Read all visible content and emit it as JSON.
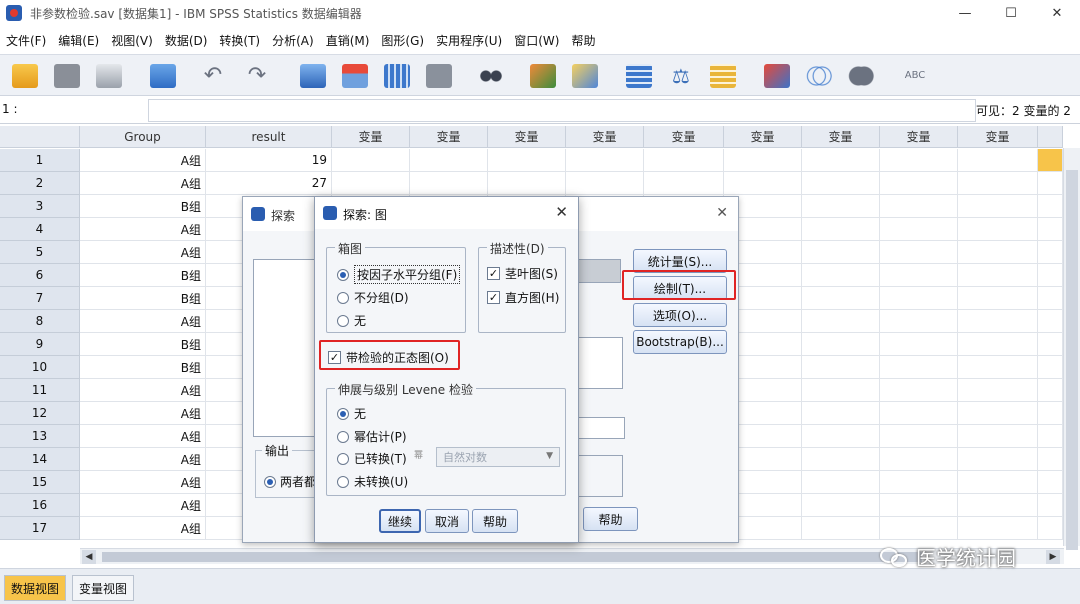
{
  "window": {
    "title": "非参数检验.sav [数据集1] - IBM SPSS Statistics 数据编辑器",
    "min": "—",
    "max": "☐",
    "close": "✕"
  },
  "menu": [
    "文件(F)",
    "编辑(E)",
    "视图(V)",
    "数据(D)",
    "转换(T)",
    "分析(A)",
    "直销(M)",
    "图形(G)",
    "实用程序(U)",
    "窗口(W)",
    "帮助"
  ],
  "cellbar": {
    "ref": "1 :",
    "visible": "可见：2 变量的 2"
  },
  "grid": {
    "columns": [
      "Group",
      "result",
      "变量",
      "变量",
      "变量",
      "变量",
      "变量",
      "变量",
      "变量",
      "变量",
      "变量",
      "变量"
    ],
    "rows": [
      {
        "n": "1",
        "group": "A组",
        "result": "19"
      },
      {
        "n": "2",
        "group": "A组",
        "result": "27"
      },
      {
        "n": "3",
        "group": "B组",
        "result": ""
      },
      {
        "n": "4",
        "group": "A组",
        "result": ""
      },
      {
        "n": "5",
        "group": "A组",
        "result": ""
      },
      {
        "n": "6",
        "group": "B组",
        "result": ""
      },
      {
        "n": "7",
        "group": "B组",
        "result": ""
      },
      {
        "n": "8",
        "group": "A组",
        "result": ""
      },
      {
        "n": "9",
        "group": "B组",
        "result": ""
      },
      {
        "n": "10",
        "group": "B组",
        "result": ""
      },
      {
        "n": "11",
        "group": "A组",
        "result": ""
      },
      {
        "n": "12",
        "group": "A组",
        "result": ""
      },
      {
        "n": "13",
        "group": "A组",
        "result": ""
      },
      {
        "n": "14",
        "group": "A组",
        "result": ""
      },
      {
        "n": "15",
        "group": "A组",
        "result": ""
      },
      {
        "n": "16",
        "group": "A组",
        "result": ""
      },
      {
        "n": "17",
        "group": "A组",
        "result": ""
      }
    ]
  },
  "bottom_tabs": {
    "data_view": "数据视图",
    "variable_view": "变量视图"
  },
  "explore_dialog": {
    "title": "探索",
    "close": "✕",
    "statistics_button": "统计量(S)...",
    "plots_button": "绘制(T)...",
    "options_button": "选项(O)...",
    "bootstrap_button": "Bootstrap(B)...",
    "output_legend": "输出",
    "output_option": "两者都",
    "help_button": "帮助"
  },
  "plots_dialog": {
    "title": "探索: 图",
    "close": "✕",
    "boxplot_legend": "箱图",
    "boxplot_options": [
      {
        "label": "按因子水平分组(F)",
        "selected": true
      },
      {
        "label": "不分组(D)",
        "selected": false
      },
      {
        "label": "无",
        "selected": false
      }
    ],
    "descriptive_legend": "描述性(D)",
    "descriptive_options": [
      {
        "label": "茎叶图(S)",
        "checked": true
      },
      {
        "label": "直方图(H)",
        "checked": true
      }
    ],
    "normality_label": "带检验的正态图(O)",
    "normality_checked": true,
    "levene_legend": "伸展与级别 Levene 检验",
    "levene_options": [
      {
        "label": "无",
        "selected": true
      },
      {
        "label": "幂估计(P)",
        "selected": false
      },
      {
        "label": "已转换(T)",
        "selected": false
      },
      {
        "label": "未转换(U)",
        "selected": false
      }
    ],
    "power_prefix": "幂",
    "power_dropdown": "自然对数",
    "continue_button": "继续",
    "cancel_button": "取消",
    "help_button": "帮助"
  },
  "watermark": "医学统计园"
}
